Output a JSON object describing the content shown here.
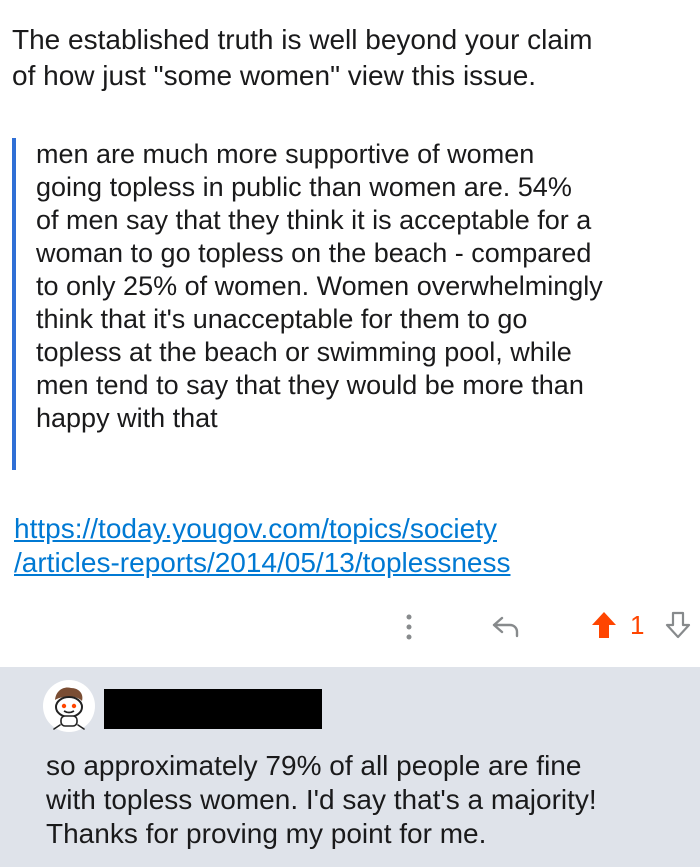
{
  "comment": {
    "intro_lines": [
      "The established truth is well beyond your claim",
      "of how just \"some women\" view this issue."
    ],
    "quote_lines": [
      "men are much more supportive of women",
      "going topless in public than women are. 54%",
      "of men say that they think it is acceptable for a",
      "woman to go topless on the beach - compared",
      "to only 25% of women. Women overwhelmingly",
      "think that it's unacceptable for them to go",
      "topless at the beach or swimming pool, while",
      "men tend to say that they would be more than",
      "happy with that"
    ],
    "link_lines": [
      "https://today.yougov.com/topics/society",
      "/articles-reports/2014/05/13/toplessness"
    ],
    "vote_count": "1"
  },
  "reply": {
    "text_lines": [
      "so approximately 79% of all people are fine",
      "with topless women. I'd say that's a majority!",
      "Thanks for proving my point for me."
    ]
  },
  "icons": {
    "more": "more-vertical-icon",
    "reply": "reply-arrow-icon",
    "upvote": "upvote-arrow-icon",
    "downvote": "downvote-arrow-icon",
    "avatar": "snoo-avatar-icon"
  },
  "colors": {
    "link": "#0079d3",
    "upvote": "#ff4500",
    "quote_bar": "#2f6fd6",
    "reply_background": "#dfe3ea"
  }
}
